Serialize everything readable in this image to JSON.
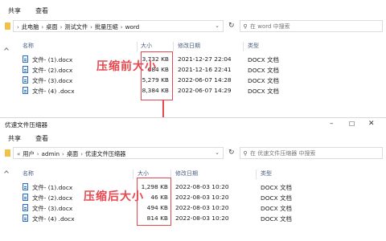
{
  "window1": {
    "ribbon_tabs": [
      "共享",
      "查看"
    ],
    "breadcrumb": [
      "此电脑",
      "桌面",
      "测试文件",
      "批量压缩",
      "word"
    ],
    "search_placeholder": "在 word 中搜索",
    "headers": {
      "name": "名称",
      "size": "大小",
      "date": "修改日期",
      "type": "类型"
    },
    "files": [
      {
        "name": "文件- (1).docx",
        "size": "3,732 KB",
        "date": "2021-12-27 22:04",
        "type": "DOCX 文档"
      },
      {
        "name": "文件- (2).docx",
        "size": "684 KB",
        "date": "2021-12-16 22:41",
        "type": "DOCX 文档"
      },
      {
        "name": "文件- (3).docx",
        "size": "5,279 KB",
        "date": "2022-06-07 14:28",
        "type": "DOCX 文档"
      },
      {
        "name": "文件- (4) .docx",
        "size": "8,384 KB",
        "date": "2022-06-07 14:29",
        "type": "DOCX 文档"
      }
    ],
    "annotation": "压缩前大小"
  },
  "window2": {
    "title": "优速文件压缩器",
    "ribbon_tabs": [
      "共享",
      "查看"
    ],
    "breadcrumb": [
      "用户",
      "admin",
      "桌面",
      "优速文件压缩器"
    ],
    "search_placeholder": "在 优速文件压缩器 中搜索",
    "headers": {
      "name": "名称",
      "size": "大小",
      "date": "修改日期",
      "type": "类型"
    },
    "files": [
      {
        "name": "文件- (1).docx",
        "size": "1,298 KB",
        "date": "2022-08-03 10:20",
        "type": "DOCX 文档"
      },
      {
        "name": "文件- (2).docx",
        "size": "46 KB",
        "date": "2022-08-03 10:20",
        "type": "DOCX 文档"
      },
      {
        "name": "文件- (3).docx",
        "size": "494 KB",
        "date": "2022-08-03 10:20",
        "type": "DOCX 文档"
      },
      {
        "name": "文件- (4) .docx",
        "size": "814 KB",
        "date": "2022-08-03 10:20",
        "type": "DOCX 文档"
      }
    ],
    "annotation": "压缩后大小"
  },
  "colors": {
    "accent_red": "#e8474f",
    "header_text": "#4a5f80",
    "folder": "#f0c24a"
  }
}
